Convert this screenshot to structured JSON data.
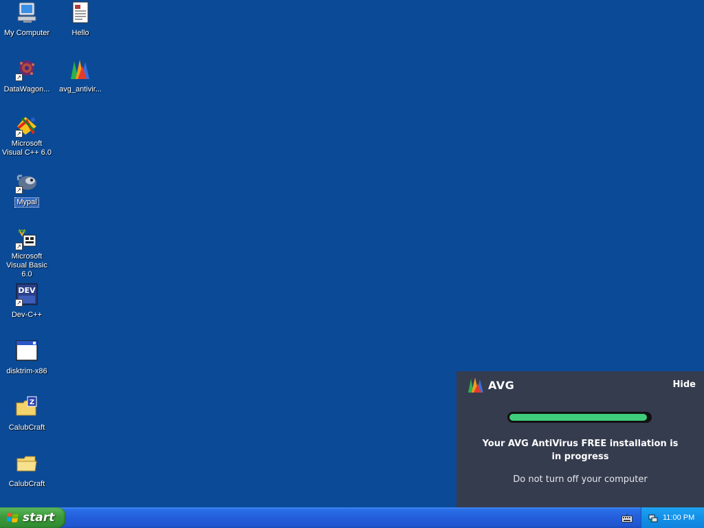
{
  "desktop": {
    "icons": [
      {
        "label": "My Computer",
        "icon": "my-computer-icon"
      },
      {
        "label": "Hello",
        "icon": "document-icon"
      },
      {
        "label": "DataWagon...",
        "icon": "datawagon-icon"
      },
      {
        "label": "avg_antivir...",
        "icon": "avg-installer-icon"
      },
      {
        "label": "Microsoft Visual C++ 6.0",
        "icon": "visual-cpp-icon"
      },
      {
        "label": "Mypal",
        "icon": "mypal-icon"
      },
      {
        "label": "Microsoft Visual Basic 6.0",
        "icon": "visual-basic-icon"
      },
      {
        "label": "Dev-C++",
        "icon": "dev-cpp-icon",
        "badge": "DEV"
      },
      {
        "label": "disktrim-x86",
        "icon": "application-window-icon"
      },
      {
        "label": "CalubCraft",
        "icon": "zipped-folder-icon",
        "badge": "Z"
      },
      {
        "label": "CalubCraft",
        "icon": "folder-icon"
      }
    ]
  },
  "avg_popup": {
    "brand": "AVG",
    "hide_label": "Hide",
    "progress": 0.98,
    "message": "Your AVG AntiVirus FREE installation is in progress",
    "submessage": "Do not turn off your computer",
    "accent_color": "#3fcc7b"
  },
  "taskbar": {
    "start_label": "start",
    "clock": "11:00 PM"
  }
}
